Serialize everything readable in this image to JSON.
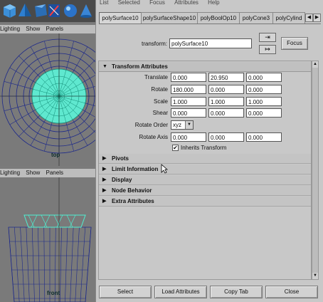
{
  "shelf": {
    "icons": [
      "cube-icon",
      "pyramid-icon",
      "prism-icon",
      "polygon-cylinder-icon",
      "sphere-icon",
      "cone-icon"
    ]
  },
  "viewport_top": {
    "menu": [
      "Lighting",
      "Show",
      "Panels"
    ],
    "camera_label": "top"
  },
  "viewport_front": {
    "menu": [
      "Lighting",
      "Show",
      "Panels"
    ],
    "camera_label": "front"
  },
  "ae_menu": [
    "List",
    "Selected",
    "Focus",
    "Attributes",
    "Help"
  ],
  "tabs": [
    "polySurface10",
    "polySurfaceShape10",
    "polyBoolOp10",
    "polyCone3",
    "polyCylind"
  ],
  "tab_arrows": {
    "left": "◀",
    "right": "▶"
  },
  "transform": {
    "label": "transform:",
    "value": "polySurface10",
    "focus_label": "Focus",
    "load_icon_glyph": "⇥",
    "select_icon_glyph": "↦"
  },
  "sections": {
    "transform_attributes": "Transform Attributes",
    "pivots": "Pivots",
    "limit_information": "Limit Information",
    "display": "Display",
    "node_behavior": "Node Behavior",
    "extra_attributes": "Extra Attributes"
  },
  "arrows": {
    "open": "▼",
    "closed": "▶"
  },
  "attributes": {
    "translate": {
      "label": "Translate",
      "values": [
        "0.000",
        "20.950",
        "0.000"
      ]
    },
    "rotate": {
      "label": "Rotate",
      "values": [
        "180.000",
        "0.000",
        "0.000"
      ]
    },
    "scale": {
      "label": "Scale",
      "values": [
        "1.000",
        "1.000",
        "1.000"
      ]
    },
    "shear": {
      "label": "Shear",
      "values": [
        "0.000",
        "0.000",
        "0.000"
      ]
    },
    "rotate_order": {
      "label": "Rotate Order",
      "value": "xyz"
    },
    "rotate_axis": {
      "label": "Rotate Axis",
      "values": [
        "0.000",
        "0.000",
        "0.000"
      ]
    },
    "inherits_transform": {
      "label": "Inherits Transform",
      "checked": true,
      "mark": "✔"
    }
  },
  "bottom_buttons": [
    "Select",
    "Load Attributes",
    "Copy Tab",
    "Close"
  ],
  "colors": {
    "wire": "#1e2a8a",
    "selected": "#38e6c8",
    "viewport": "#7a7a7a"
  }
}
